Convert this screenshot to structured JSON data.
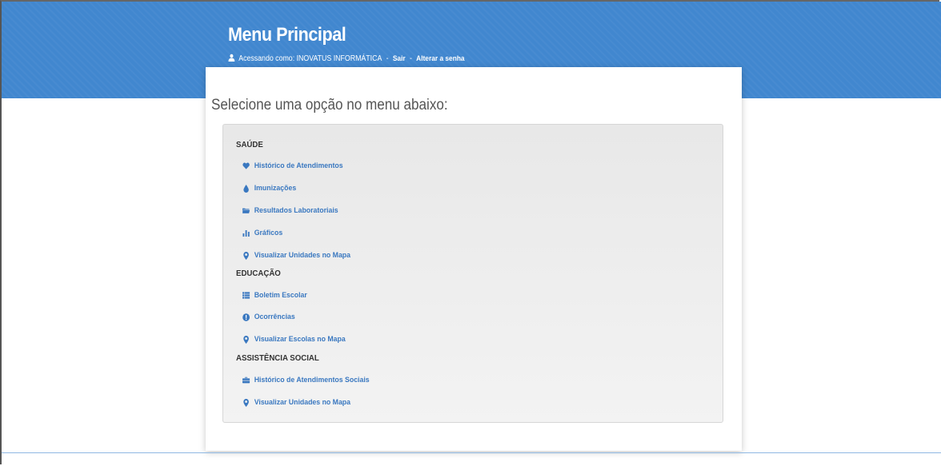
{
  "header": {
    "title": "Menu Principal",
    "user_prefix": "Acessando como: INOVATUS INFORMÁTICA",
    "separator": "-",
    "logout_label": "Sair",
    "change_password_label": "Alterar a senha"
  },
  "main": {
    "prompt": "Selecione uma opção no menu abaixo:"
  },
  "sections": [
    {
      "title": "SAÚDE",
      "items": [
        {
          "label": "Histórico de Atendimentos",
          "icon": "heart-icon"
        },
        {
          "label": "Imunizações",
          "icon": "drop-icon"
        },
        {
          "label": "Resultados Laboratoriais",
          "icon": "folder-open-icon"
        },
        {
          "label": "Gráficos",
          "icon": "bar-chart-icon"
        },
        {
          "label": "Visualizar Unidades no Mapa",
          "icon": "map-marker-icon"
        }
      ]
    },
    {
      "title": "EDUCAÇÃO",
      "items": [
        {
          "label": "Boletim Escolar",
          "icon": "list-icon"
        },
        {
          "label": "Ocorrências",
          "icon": "exclamation-circle-icon"
        },
        {
          "label": "Visualizar Escolas no Mapa",
          "icon": "map-marker-icon"
        }
      ]
    },
    {
      "title": "ASSISTÊNCIA SOCIAL",
      "items": [
        {
          "label": "Histórico de Atendimentos Sociais",
          "icon": "briefcase-icon"
        },
        {
          "label": "Visualizar Unidades no Mapa",
          "icon": "map-marker-icon"
        }
      ]
    }
  ],
  "colors": {
    "header_bg": "#4187cf",
    "link": "#3a78c0",
    "section_text": "#333333"
  }
}
